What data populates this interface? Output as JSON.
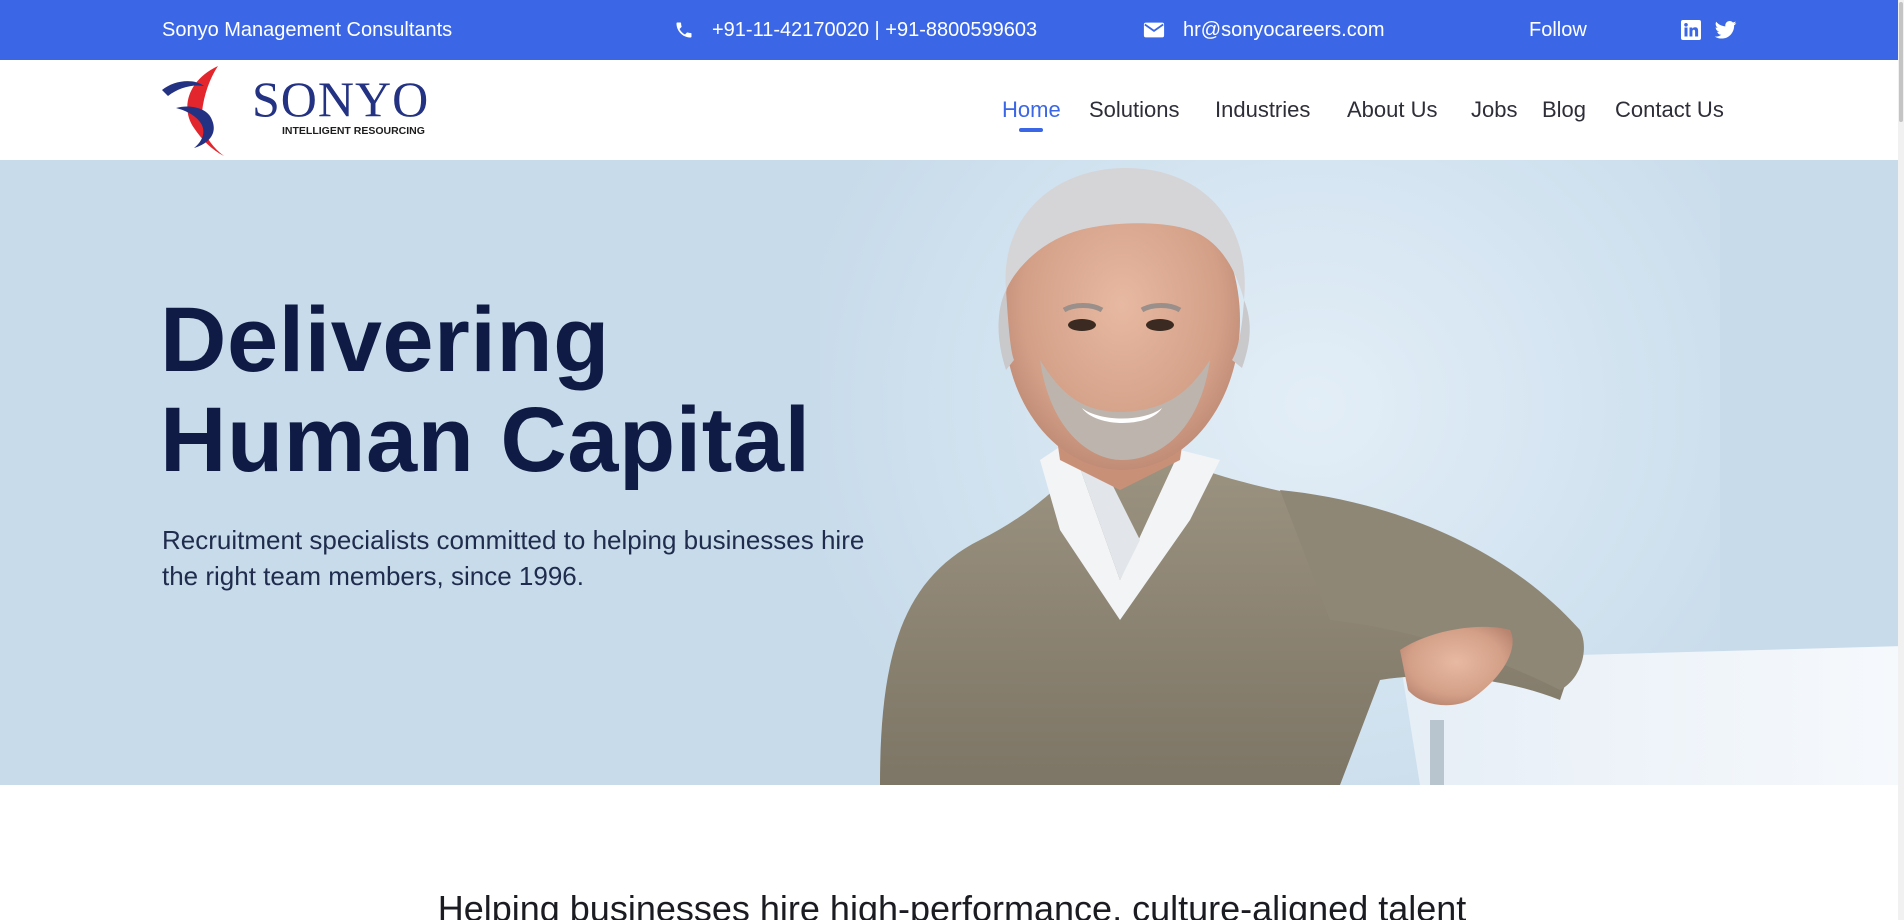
{
  "topbar": {
    "company": "Sonyo Management Consultants",
    "phone": "+91-11-42170020 | +91-8800599603",
    "email": "hr@sonyocareers.com",
    "follow": "Follow",
    "phone_icon": "phone-icon",
    "email_icon": "envelope-icon",
    "social_icons": [
      "linkedin-icon",
      "twitter-icon"
    ],
    "background_color": "#3b67e6"
  },
  "logo": {
    "wordmark": "SONYO",
    "tagline": "INTELLIGENT RESOURCING"
  },
  "nav": {
    "items": [
      {
        "label": "Home",
        "active": true
      },
      {
        "label": "Solutions",
        "active": false
      },
      {
        "label": "Industries",
        "active": false
      },
      {
        "label": "About Us",
        "active": false
      },
      {
        "label": "Jobs",
        "active": false
      },
      {
        "label": "Blog",
        "active": false
      },
      {
        "label": "Contact Us",
        "active": false
      }
    ],
    "active_color": "#3b67e6"
  },
  "hero": {
    "title_line1": "Delivering",
    "title_line2": "Human Capital",
    "subtitle": "Recruitment specialists committed to helping businesses hire the right team members, since 1996.",
    "title_color": "#0f1b45",
    "background_color": "#c8dbea"
  },
  "section": {
    "tagline": "Helping businesses hire high-performance, culture-aligned talent"
  }
}
